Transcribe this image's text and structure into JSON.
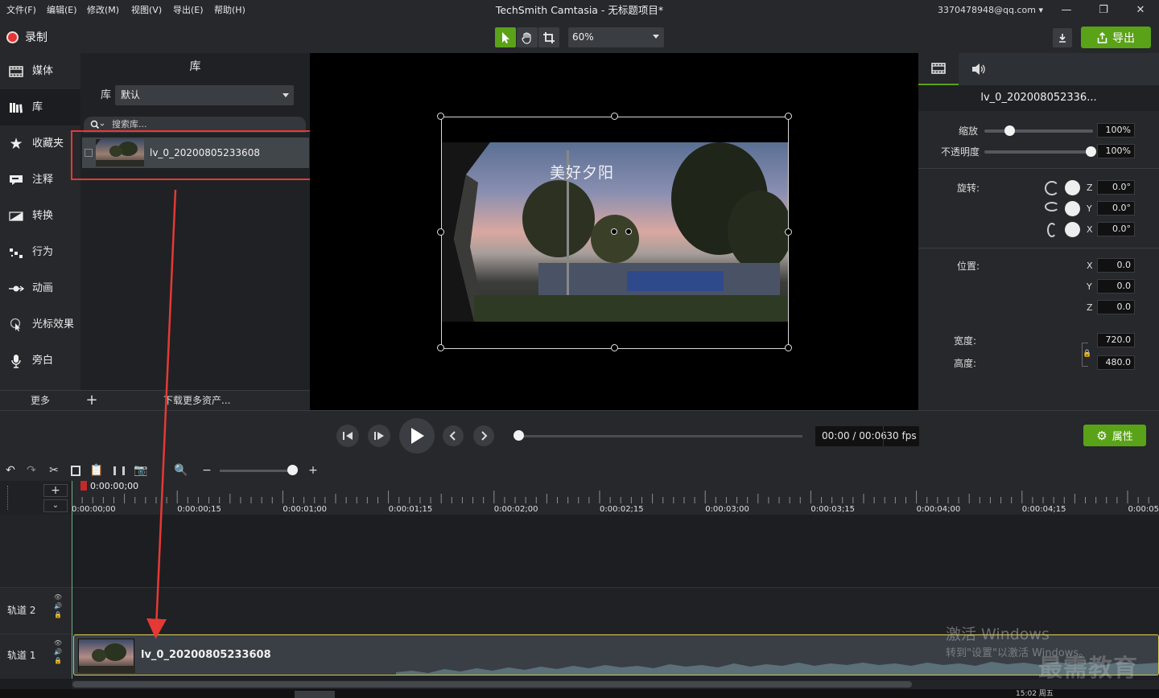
{
  "menu": [
    "文件(F)",
    "编辑(E)",
    "修改(M)",
    "视图(V)",
    "导出(E)",
    "帮助(H)"
  ],
  "window_title": "TechSmith Camtasia - 无标题项目*",
  "account": "3370478948@qq.com",
  "window_controls": [
    "—",
    "❐",
    "✕"
  ],
  "toolbar": {
    "record_label": "录制",
    "zoom_value": "60%",
    "export_label": "导出"
  },
  "sidebar": {
    "items": [
      {
        "label": "媒体",
        "icon": "film-icon"
      },
      {
        "label": "库",
        "icon": "books-icon"
      },
      {
        "label": "收藏夹",
        "icon": "star-icon"
      },
      {
        "label": "注释",
        "icon": "annotation-icon"
      },
      {
        "label": "转换",
        "icon": "transition-icon"
      },
      {
        "label": "行为",
        "icon": "behavior-icon"
      },
      {
        "label": "动画",
        "icon": "animation-icon"
      },
      {
        "label": "光标效果",
        "icon": "cursor-icon"
      },
      {
        "label": "旁白",
        "icon": "microphone-icon"
      }
    ],
    "active_index": 1,
    "more_label": "更多",
    "add_label": "+",
    "more_assets": "下载更多资产..."
  },
  "library": {
    "title": "库",
    "select_label": "库",
    "select_value": "默认",
    "search_placeholder": "搜索库...",
    "item_label": "lv_0_20200805233608"
  },
  "canvas": {
    "caption": "美好夕阳"
  },
  "properties": {
    "title": "lv_0_202008052336...",
    "scale_label": "缩放",
    "scale_value": "100%",
    "scale_level": 0.23,
    "opacity_label": "不透明度",
    "opacity_value": "100%",
    "opacity_level": 1.0,
    "rotation_label": "旋转:",
    "rotation": [
      {
        "axis": "Z",
        "value": "0.0°"
      },
      {
        "axis": "Y",
        "value": "0.0°"
      },
      {
        "axis": "X",
        "value": "0.0°"
      }
    ],
    "position_label": "位置:",
    "position": [
      {
        "axis": "X",
        "value": "0.0"
      },
      {
        "axis": "Y",
        "value": "0.0"
      },
      {
        "axis": "Z",
        "value": "0.0"
      }
    ],
    "width_label": "宽度:",
    "width_value": "720.0",
    "height_label": "高度:",
    "height_value": "480.0"
  },
  "playback": {
    "time": "00:00 / 00:06",
    "fps": "30 fps",
    "properties_label": "属性",
    "progress": 0.0
  },
  "timeline": {
    "playhead_time": "0:00:00;00",
    "ticks": [
      "0:00:00;00",
      "0:00:00;15",
      "0:00:01;00",
      "0:00:01;15",
      "0:00:02;00",
      "0:00:02;15",
      "0:00:03;00",
      "0:00:03;15",
      "0:00:04;00",
      "0:00:04;15",
      "0:00:05"
    ],
    "track2_label": "轨道 2",
    "track1_label": "轨道 1",
    "clip_label": "lv_0_20200805233608"
  },
  "overlay": {
    "activate_line1": "激活 Windows",
    "activate_line2": "转到\"设置\"以激活 Windows。",
    "watermark": "最需教育",
    "status_clock": "15:02 周五"
  },
  "colors": {
    "accent_green": "#5aa217",
    "record_red": "#e23636",
    "highlight_red": "#e53935",
    "clip_border": "#d8c84a"
  }
}
